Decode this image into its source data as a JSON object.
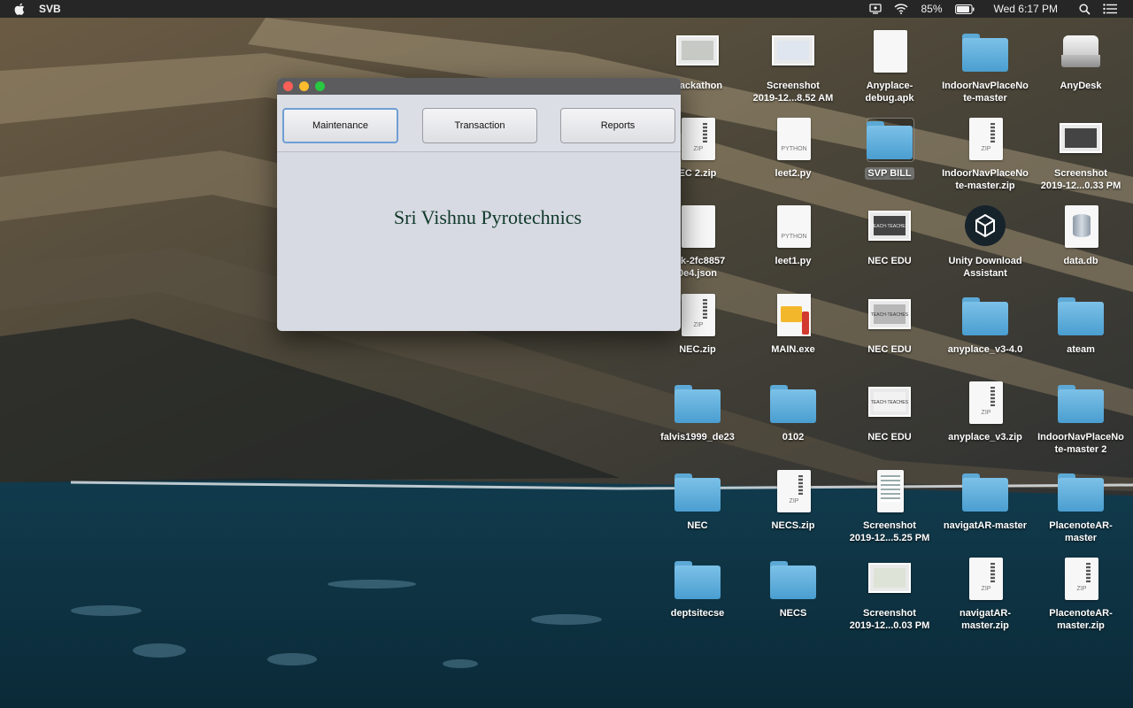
{
  "menubar": {
    "app_name": "SVB",
    "battery_percent": "85%",
    "clock": "Wed 6:17 PM"
  },
  "window": {
    "buttons": {
      "maintenance": "Maintenance",
      "transaction": "Transaction",
      "reports": "Reports"
    },
    "company_name": "Sri Vishnu Pyrotechnics"
  },
  "desktop": {
    "icons": {
      "hackathon": "Hackathon",
      "screenshot_1": "Screenshot\n2019-12...8.52 AM",
      "anyplace_debug": "Anyplace-\ndebug.apk",
      "indoornav_master": "IndoorNavPlaceNo\nte-master",
      "anydesk": "AnyDesk",
      "nec2_zip": "EC 2.zip",
      "leet2": "leet2.py",
      "svp_bill": "SVP BILL",
      "indoornav_zip": "IndoorNavPlaceNo\nte-master.zip",
      "screenshot_2": "Screenshot\n2019-12...0.33 PM",
      "json_file": "ack-2fc8857\n0e4.json",
      "leet1": "leet1.py",
      "nec_edu_1": "NEC EDU",
      "unity": "Unity Download\nAssistant",
      "data_db": "data.db",
      "nec_zip": "NEC.zip",
      "main_exe": "MAIN.exe",
      "nec_edu_2": "NEC EDU",
      "anyplace_v3_40": "anyplace_v3-4.0",
      "ateam": "ateam",
      "falvis": "falvis1999_de23",
      "f0102": "0102",
      "nec_edu_3": "NEC EDU",
      "anyplace_v3_zip": "anyplace_v3.zip",
      "indoornav_master2": "IndoorNavPlaceNo\nte-master 2",
      "nec": "NEC",
      "necs_zip": "NECS.zip",
      "screenshot_3": "Screenshot\n2019-12...5.25 PM",
      "navigatar_master": "navigatAR-master",
      "placenote_master": "PlacenoteAR-\nmaster",
      "deptsitecse": "deptsitecse",
      "necs": "NECS",
      "screenshot_4": "Screenshot\n2019-12...0.03 PM",
      "navigatar_zip": "navigatAR-\nmaster.zip",
      "placenote_zip": "PlacenoteAR-\nmaster.zip"
    },
    "tags": {
      "zip": "ZIP",
      "python": "PYTHON",
      "teach": "TEACH·TEACHES"
    }
  },
  "colors": {
    "window_bg": "#d7dae2",
    "company_text": "#10382b",
    "folder_blue": "#5da9d6",
    "close": "#fe5f57",
    "minimize": "#febc2e",
    "maximize": "#28c840"
  }
}
